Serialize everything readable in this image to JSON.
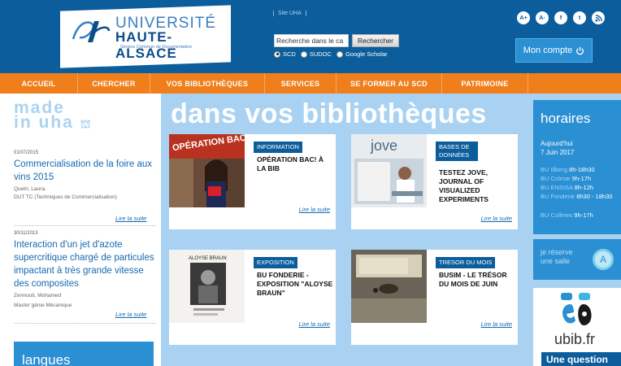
{
  "header": {
    "logo_line1": "UNIVERSITÉ",
    "logo_line2": "HAUTE-ALSACE",
    "logo_line3": "Service Commun de Documentation",
    "site_link": "Site UHA",
    "search_placeholder": "Recherche dans le ca",
    "search_button": "Rechercher",
    "radios": [
      {
        "label": "SCD",
        "selected": true
      },
      {
        "label": "SUDOC",
        "selected": false
      },
      {
        "label": "Google Scholar",
        "selected": false
      }
    ],
    "top_icons": [
      "A+",
      "A-",
      "f",
      "t",
      "rss"
    ],
    "account_button": "Mon compte"
  },
  "nav": {
    "items": [
      {
        "label": "ACCUEIL"
      },
      {
        "label": "CHERCHER"
      },
      {
        "label": "VOS BIBLIOTHÈQUES"
      },
      {
        "label": "SERVICES"
      },
      {
        "label": "SE FORMER AU SCD"
      },
      {
        "label": "PATRIMOINE"
      }
    ]
  },
  "left": {
    "made_line1": "made",
    "made_line2": "in uha",
    "news": [
      {
        "date": "01/07/2015",
        "title": "Commercialisation de la foire aux vins 2015",
        "author": "Quetri, Laura.",
        "degree": "DUT TC (Techniques de Commercialisation)",
        "more": "Lire la suite"
      },
      {
        "date": "30/11/2013",
        "title": "Interaction d'un jet d'azote supercritique chargé de particules impactant à très grande vitesse des composites",
        "author": "Zermouti, Mohamed",
        "degree": "Master génie Mécanique",
        "more": "Lire la suite"
      }
    ],
    "langues": "langues"
  },
  "main": {
    "title": "dans vos bibliothèques",
    "cards": [
      {
        "tag": "INFORMATION",
        "title": "OPÉRATION BAC! À LA BIB",
        "more": "Lire la suite",
        "image_caption": "OPÉRATION BAC!"
      },
      {
        "tag": "BASES DE DONNÉES",
        "title": "TESTEZ JOVE, JOURNAL OF VISUALIZED EXPERIMENTS",
        "more": "Lire la suite",
        "image_caption": "jove"
      },
      {
        "tag": "EXPOSITION",
        "title": "BU FONDERIE - EXPOSITION \"ALOYSE BRAUN\"",
        "more": "Lire la suite",
        "image_caption": "ALOYSE BRAUN"
      },
      {
        "tag": "TRESOR DU MOIS",
        "title": "BUSIM - LE TRÉSOR DU MOIS DE JUIN",
        "more": "Lire la suite",
        "image_caption": ""
      }
    ]
  },
  "right": {
    "horaires_title": "horaires",
    "today_label": "Aujourd'hui",
    "today_date": "7 Juin 2017",
    "hours": [
      {
        "loc": "BU Illberg",
        "time": "8h-18h30"
      },
      {
        "loc": "BU Colmar",
        "time": "9h-17h"
      },
      {
        "loc": "BU ENSISA",
        "time": "8h-12h"
      },
      {
        "loc": "BU Fonderie",
        "time": "8h30 - 18h30"
      },
      {
        "loc": "BU Collines",
        "time": "9h-17h"
      }
    ],
    "reserve_line1": "je réserve",
    "reserve_line2": "une salle",
    "ubib": "ubib.fr",
    "question": "Une question"
  }
}
